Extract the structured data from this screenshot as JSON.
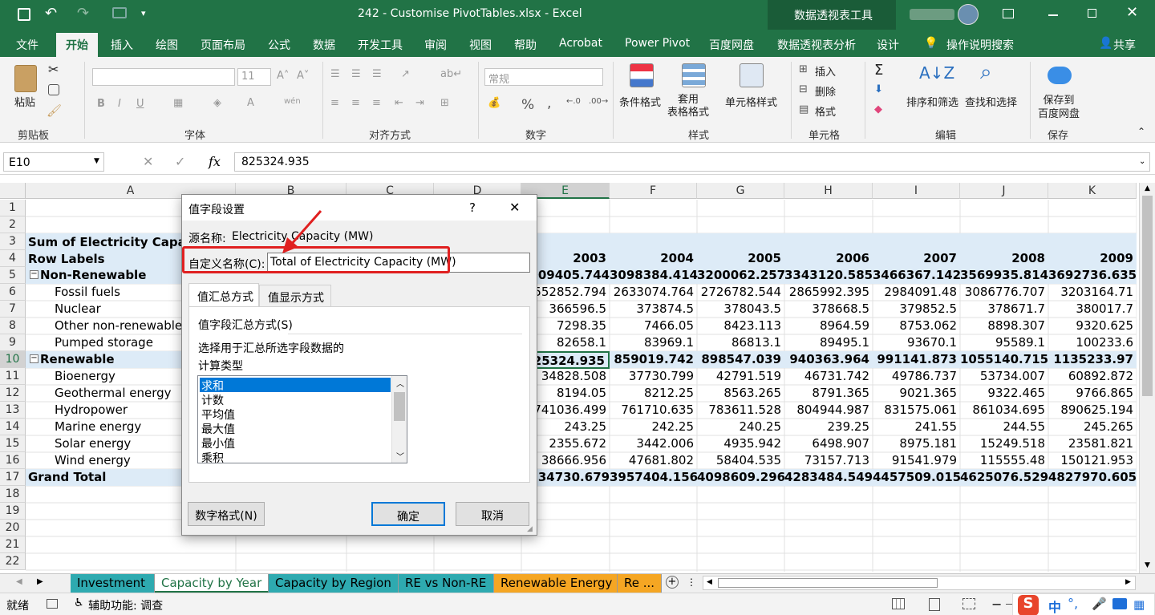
{
  "titlebar": {
    "title": "242 - Customise PivotTables.xlsx  -  Excel",
    "context_tools": "数据透视表工具"
  },
  "tabs": [
    "文件",
    "开始",
    "插入",
    "绘图",
    "页面布局",
    "公式",
    "数据",
    "开发工具",
    "审阅",
    "视图",
    "帮助",
    "Acrobat",
    "Power Pivot",
    "百度网盘",
    "数据透视表分析",
    "设计"
  ],
  "tell_me": "操作说明搜索",
  "share": "共享",
  "ribbon": {
    "paste": "粘贴",
    "clipboard": "剪贴板",
    "font_group": "字体",
    "font_size": "11",
    "align_group": "对齐方式",
    "number_format": "常规",
    "number_group": "数字",
    "cond_format": "条件格式",
    "table_format": "套用\n表格格式",
    "cell_style": "单元格样式",
    "styles_group": "样式",
    "insert": "插入",
    "delete": "删除",
    "format": "格式",
    "cells_group": "单元格",
    "sort_filter": "排序和筛选",
    "find_select": "查找和选择",
    "edit_group": "编辑",
    "save_baidu": "保存到\n百度网盘",
    "save_group": "保存",
    "percent": "%",
    "comma": ","
  },
  "namebox": "E10",
  "formula": "825324.935",
  "columns": [
    "A",
    "B",
    "C",
    "D",
    "E",
    "F",
    "G",
    "H",
    "I",
    "J",
    "K"
  ],
  "rows": [
    "1",
    "2",
    "3",
    "4",
    "5",
    "6",
    "7",
    "8",
    "9",
    "10",
    "11",
    "12",
    "13",
    "14",
    "15",
    "16",
    "17",
    "18",
    "19",
    "20",
    "21",
    "22"
  ],
  "pivot": {
    "title": "Sum of Electricity Capacity",
    "row_labels": "Row Labels",
    "years": [
      "2003",
      "2004",
      "2005",
      "2006",
      "2007",
      "2008",
      "2009"
    ],
    "lines": [
      {
        "label": "Non-Renewable",
        "type": "group",
        "values": [
          "3009405.744",
          "3098384.414",
          "3200062.257",
          "3343120.585",
          "3466367.142",
          "3569935.814",
          "3692736.635"
        ]
      },
      {
        "label": "Fossil fuels",
        "type": "item",
        "values": [
          "2552852.794",
          "2633074.764",
          "2726782.544",
          "2865992.395",
          "2984091.48",
          "3086776.707",
          "3203164.71"
        ]
      },
      {
        "label": "Nuclear",
        "type": "item",
        "values": [
          "366596.5",
          "373874.5",
          "378043.5",
          "378668.5",
          "379852.5",
          "378671.7",
          "380017.7"
        ]
      },
      {
        "label": "Other non-renewable",
        "type": "item",
        "values": [
          "7298.35",
          "7466.05",
          "8423.113",
          "8964.59",
          "8753.062",
          "8898.307",
          "9320.625"
        ]
      },
      {
        "label": "Pumped storage",
        "type": "item",
        "values": [
          "82658.1",
          "83969.1",
          "86813.1",
          "89495.1",
          "93670.1",
          "95589.1",
          "100233.6"
        ]
      },
      {
        "label": "Renewable",
        "type": "group",
        "values": [
          "825324.935",
          "859019.742",
          "898547.039",
          "940363.964",
          "991141.873",
          "1055140.715",
          "1135233.97"
        ]
      },
      {
        "label": "Bioenergy",
        "type": "item",
        "values": [
          "34828.508",
          "37730.799",
          "42791.519",
          "46731.742",
          "49786.737",
          "53734.007",
          "60892.872"
        ]
      },
      {
        "label": "Geothermal energy",
        "type": "item",
        "values": [
          "8194.05",
          "8212.25",
          "8563.265",
          "8791.365",
          "9021.365",
          "9322.465",
          "9766.865"
        ]
      },
      {
        "label": "Hydropower",
        "type": "item",
        "values": [
          "741036.499",
          "761710.635",
          "783611.528",
          "804944.987",
          "831575.061",
          "861034.695",
          "890625.194"
        ]
      },
      {
        "label": "Marine energy",
        "type": "item",
        "values": [
          "243.25",
          "242.25",
          "240.25",
          "239.25",
          "241.55",
          "244.55",
          "245.265"
        ]
      },
      {
        "label": "Solar energy",
        "type": "item",
        "values": [
          "2355.672",
          "3442.006",
          "4935.942",
          "6498.907",
          "8975.181",
          "15249.518",
          "23581.821"
        ]
      },
      {
        "label": "Wind energy",
        "type": "item",
        "values": [
          "38666.956",
          "47681.802",
          "58404.535",
          "73157.713",
          "91541.979",
          "115555.48",
          "150121.953"
        ]
      },
      {
        "label": "Grand Total",
        "type": "total",
        "values": [
          "3834730.679",
          "3957404.156",
          "4098609.296",
          "4283484.549",
          "4457509.015",
          "4625076.529",
          "4827970.605"
        ]
      }
    ]
  },
  "dialog": {
    "title": "值字段设置",
    "help": "?",
    "close": "✕",
    "source_label": "源名称:",
    "source_value": "Electricity Capacity (MW)",
    "custom_label": "自定义名称(C):",
    "custom_value": "Total of Electricity Capacity (MW)",
    "tab_summarize": "值汇总方式",
    "tab_show": "值显示方式",
    "section": "值字段汇总方式(S)",
    "desc1": "选择用于汇总所选字段数据的",
    "desc2": "计算类型",
    "options": [
      "求和",
      "计数",
      "平均值",
      "最大值",
      "最小值",
      "乘积"
    ],
    "number_format_btn": "数字格式(N)",
    "ok": "确定",
    "cancel": "取消"
  },
  "sheet_tabs": [
    "Investment",
    "Capacity by Year",
    "Capacity by Region",
    "RE vs Non-RE",
    "Renewable Energy",
    "Re ..."
  ],
  "status": {
    "ready": "就绪",
    "accessibility": "辅助功能: 调查",
    "ime": "中"
  },
  "colors": {
    "excel_green": "#217346",
    "pivot_band": "#ddebf7",
    "highlight_red": "#e02020",
    "tab_teal": "#2eaab0",
    "tab_orange": "#f5a623"
  }
}
